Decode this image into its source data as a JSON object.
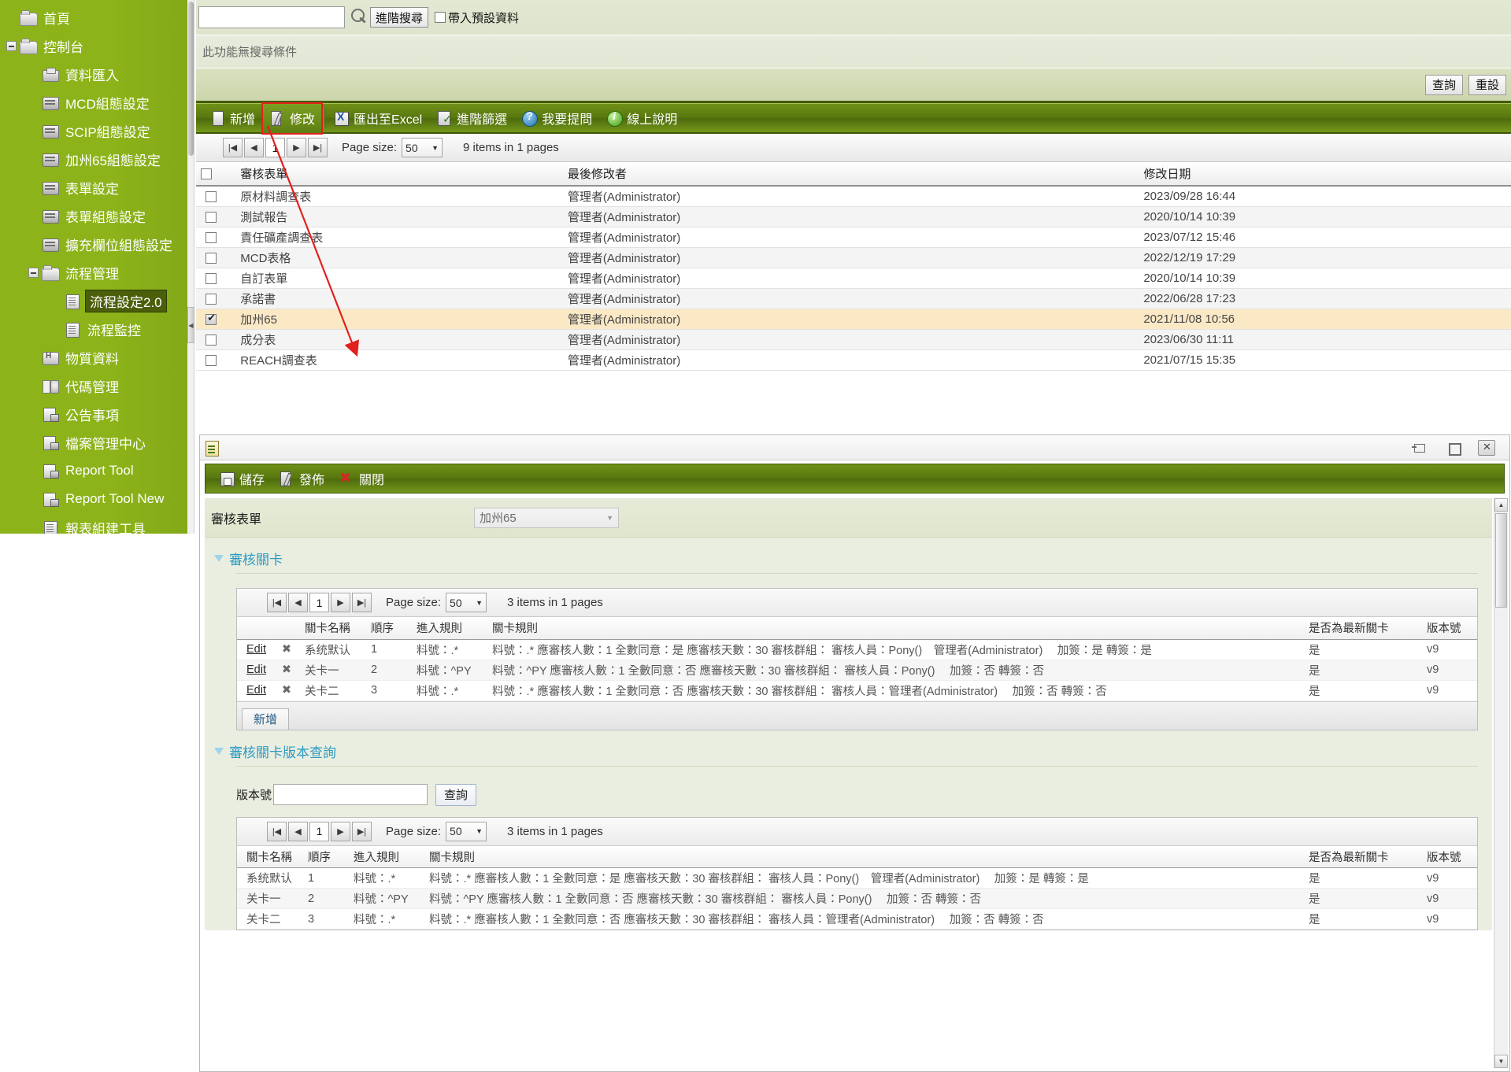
{
  "sidebar": {
    "items": [
      {
        "label": "首頁",
        "level": 1,
        "icon": "folder-icon",
        "expander": "none",
        "selected": false
      },
      {
        "label": "控制台",
        "level": 1,
        "icon": "folder-icon",
        "expander": "minus",
        "selected": false
      },
      {
        "label": "資料匯入",
        "level": 2,
        "icon": "import-icon",
        "expander": "none",
        "selected": false
      },
      {
        "label": "MCD組態設定",
        "level": 2,
        "icon": "config-icon",
        "expander": "none",
        "selected": false
      },
      {
        "label": "SCIP組態設定",
        "level": 2,
        "icon": "config-icon",
        "expander": "none",
        "selected": false
      },
      {
        "label": "加州65組態設定",
        "level": 2,
        "icon": "config-icon",
        "expander": "none",
        "selected": false
      },
      {
        "label": "表單設定",
        "level": 2,
        "icon": "config-icon",
        "expander": "none",
        "selected": false
      },
      {
        "label": "表單組態設定",
        "level": 2,
        "icon": "config-icon",
        "expander": "none",
        "selected": false
      },
      {
        "label": "擴充欄位組態設定",
        "level": 2,
        "icon": "config-icon",
        "expander": "none",
        "selected": false
      },
      {
        "label": "流程管理",
        "level": 2,
        "icon": "folder-icon",
        "expander": "minus",
        "selected": false
      },
      {
        "label": "流程設定2.0",
        "level": 3,
        "icon": "doc-icon",
        "expander": "none",
        "selected": true
      },
      {
        "label": "流程監控",
        "level": 3,
        "icon": "doc-icon",
        "expander": "none",
        "selected": false
      },
      {
        "label": "物質資料",
        "level": 2,
        "icon": "substance-icon",
        "expander": "none",
        "selected": false
      },
      {
        "label": "代碼管理",
        "level": 2,
        "icon": "code-icon",
        "expander": "none",
        "selected": false
      },
      {
        "label": "公告事項",
        "level": 2,
        "icon": "lockpage-icon",
        "expander": "none",
        "selected": false
      },
      {
        "label": "檔案管理中心",
        "level": 2,
        "icon": "lockpage-icon",
        "expander": "none",
        "selected": false
      },
      {
        "label": "Report Tool",
        "level": 2,
        "icon": "lockpage-icon",
        "expander": "none",
        "selected": false
      },
      {
        "label": "Report Tool New",
        "level": 2,
        "icon": "lockpage-icon",
        "expander": "none",
        "selected": false
      },
      {
        "label": "報表組建工具",
        "level": 2,
        "icon": "doc-icon",
        "expander": "none",
        "selected": false
      }
    ]
  },
  "search": {
    "value": "",
    "placeholder": "",
    "magnifier_icon": "search-icon",
    "advanced_button": "進階搜尋",
    "default_data_checkbox_label": "帶入預設資料",
    "default_data_checked": false,
    "no_condition_text": "此功能無搜尋條件",
    "query_button": "查詢",
    "reset_button": "重設"
  },
  "toolbar": {
    "items": [
      {
        "label": "新增",
        "icon": "page-icon",
        "highlighted": false
      },
      {
        "label": "修改",
        "icon": "pencil-icon",
        "highlighted": true
      },
      {
        "label": "匯出至Excel",
        "icon": "excel-icon",
        "highlighted": false
      },
      {
        "label": "進階篩選",
        "icon": "filter-icon",
        "highlighted": false
      },
      {
        "label": "我要提問",
        "icon": "question-icon",
        "highlighted": false
      },
      {
        "label": "線上說明",
        "icon": "info-icon",
        "highlighted": false
      }
    ]
  },
  "main_pager": {
    "first": "|◀",
    "prev": "◀",
    "page": "1",
    "next": "▶",
    "last": "▶|",
    "page_size_label": "Page size:",
    "page_size_value": "50",
    "items_text": "9 items in 1 pages"
  },
  "main_table": {
    "columns": [
      "審核表單",
      "最後修改者",
      "修改日期"
    ],
    "rows": [
      {
        "name": "原材料調查表",
        "modifier": "管理者(Administrator)",
        "date": "2023/09/28 16:44",
        "checked": false
      },
      {
        "name": "測試報告",
        "modifier": "管理者(Administrator)",
        "date": "2020/10/14 10:39",
        "checked": false
      },
      {
        "name": "責任礦產調查表",
        "modifier": "管理者(Administrator)",
        "date": "2023/07/12 15:46",
        "checked": false
      },
      {
        "name": "MCD表格",
        "modifier": "管理者(Administrator)",
        "date": "2022/12/19 17:29",
        "checked": false
      },
      {
        "name": "自訂表單",
        "modifier": "管理者(Administrator)",
        "date": "2020/10/14 10:39",
        "checked": false
      },
      {
        "name": "承諾書",
        "modifier": "管理者(Administrator)",
        "date": "2022/06/28 17:23",
        "checked": false
      },
      {
        "name": "加州65",
        "modifier": "管理者(Administrator)",
        "date": "2021/11/08 10:56",
        "checked": true
      },
      {
        "name": "成分表",
        "modifier": "管理者(Administrator)",
        "date": "2023/06/30 11:11",
        "checked": false
      },
      {
        "name": "REACH調查表",
        "modifier": "管理者(Administrator)",
        "date": "2021/07/15 15:35",
        "checked": false
      }
    ]
  },
  "modal": {
    "title_icon": "form-icon",
    "window_controls": [
      "pin-icon",
      "maximize-icon",
      "close-icon"
    ],
    "toolbar": [
      {
        "label": "儲存",
        "icon": "disk-icon"
      },
      {
        "label": "發佈",
        "icon": "pencil-icon"
      },
      {
        "label": "關閉",
        "icon": "close-x-icon"
      }
    ],
    "form_label": "審核表單",
    "form_value": "加州65",
    "gate_section": {
      "title": "審核關卡",
      "pager": {
        "first": "|◀",
        "prev": "◀",
        "page": "1",
        "next": "▶",
        "last": "▶|",
        "page_size_label": "Page size:",
        "page_size_value": "50",
        "items_text": "3 items in 1 pages"
      },
      "columns": [
        "",
        "",
        "關卡名稱",
        "順序",
        "進入規則",
        "關卡規則",
        "是否為最新關卡",
        "版本號"
      ],
      "rows": [
        {
          "edit": "Edit",
          "delete": "✖",
          "gate_name": "系统默认",
          "order": "1",
          "enter_rule": "料號：.*",
          "gate_rule": "料號：.* 應審核人數：1 全數同意：是 應審核天數：30 審核群組：  審核人員：Pony()　管理者(Administrator)　 加簽：是 轉簽：是",
          "is_latest": "是",
          "version": "v9"
        },
        {
          "edit": "Edit",
          "delete": "✖",
          "gate_name": "关卡一",
          "order": "2",
          "enter_rule": "料號：^PY",
          "gate_rule": "料號：^PY 應審核人數：1 全數同意：否 應審核天數：30 審核群組：  審核人員：Pony()　 加簽：否 轉簽：否",
          "is_latest": "是",
          "version": "v9"
        },
        {
          "edit": "Edit",
          "delete": "✖",
          "gate_name": "关卡二",
          "order": "3",
          "enter_rule": "料號：.*",
          "gate_rule": "料號：.* 應審核人數：1 全數同意：否 應審核天數：30 審核群組：  審核人員：管理者(Administrator)　 加簽：否 轉簽：否",
          "is_latest": "是",
          "version": "v9"
        }
      ],
      "add_button": "新增"
    },
    "version_section": {
      "title": "審核關卡版本查詢",
      "version_label": "版本號",
      "version_value": "",
      "query_button": "查詢",
      "pager": {
        "first": "|◀",
        "prev": "◀",
        "page": "1",
        "next": "▶",
        "last": "▶|",
        "page_size_label": "Page size:",
        "page_size_value": "50",
        "items_text": "3 items in 1 pages"
      },
      "columns": [
        "關卡名稱",
        "順序",
        "進入規則",
        "關卡規則",
        "是否為最新關卡",
        "版本號"
      ],
      "rows": [
        {
          "gate_name": "系统默认",
          "order": "1",
          "enter_rule": "料號：.*",
          "gate_rule": "料號：.* 應審核人數：1 全數同意：是 應審核天數：30 審核群組：  審核人員：Pony()　管理者(Administrator)　 加簽：是 轉簽：是",
          "is_latest": "是",
          "version": "v9"
        },
        {
          "gate_name": "关卡一",
          "order": "2",
          "enter_rule": "料號：^PY",
          "gate_rule": "料號：^PY 應審核人數：1 全數同意：否 應審核天數：30 審核群組：  審核人員：Pony()　 加簽：否 轉簽：否",
          "is_latest": "是",
          "version": "v9"
        },
        {
          "gate_name": "关卡二",
          "order": "3",
          "enter_rule": "料號：.*",
          "gate_rule": "料號：.* 應審核人數：1 全數同意：否 應審核天數：30 審核群組：  審核人員：管理者(Administrator)　 加簽：否 轉簽：否",
          "is_latest": "是",
          "version": "v9"
        }
      ]
    }
  },
  "colors": {
    "sidebar_green": "#8cb319",
    "toolbar_green": "#58770f",
    "annotation_red": "#e2211c",
    "selected_row": "#fbe9c6",
    "section_link_blue": "#2c9bc4"
  }
}
